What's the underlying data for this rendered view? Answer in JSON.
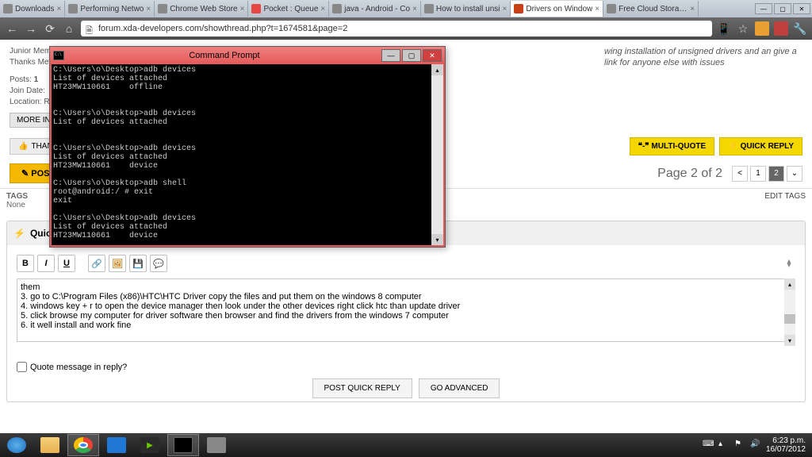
{
  "browser": {
    "tabs": [
      {
        "label": "Downloads"
      },
      {
        "label": "Performing Netwo"
      },
      {
        "label": "Chrome Web Store"
      },
      {
        "label": "Pocket : Queue"
      },
      {
        "label": "java - Android - Co"
      },
      {
        "label": "How to install unsi"
      },
      {
        "label": "Drivers on Window",
        "active": true
      },
      {
        "label": "Free Cloud Storage"
      }
    ],
    "url": "forum.xda-developers.com/showthread.php?t=1674581&page=2"
  },
  "post": {
    "rank": "Junior Mem",
    "thanks_meter": "Thanks Met",
    "posts_label": "Posts:",
    "posts_value": "1",
    "join_label": "Join Date:",
    "location_label": "Location: R",
    "more_info": "MORE INF",
    "body_text": "wing installation of unsigned drivers and\nan give a link for anyone else with issues",
    "thank_btn": "THANK",
    "post_reply": "POST R",
    "multi_quote": "❝-❞ MULTI-QUOTE",
    "quick_reply": "QUICK REPLY"
  },
  "pagination": {
    "info": "Page 2 of 2",
    "prev": "<",
    "p1": "1",
    "p2": "2",
    "more": "⌄"
  },
  "tags": {
    "label": "TAGS",
    "none": "None",
    "edit": "EDIT TAGS"
  },
  "quick_reply": {
    "header": "Quick Reply",
    "toolbar": {
      "b": "B",
      "i": "I",
      "u": "U"
    },
    "content": "them\n3. go to C:\\Program Files (x86)\\HTC\\HTC Driver copy the files and put them on the windows 8 computer\n4. windows key + r to open the device manager then look under the other devices right click htc than update driver\n5. click browse my computer for driver software then browser and find the drivers from the windows 7 computer\n6. it well install and work fine",
    "quote_label": "Quote message in reply?",
    "post_btn": "POST QUICK REPLY",
    "advanced_btn": "GO ADVANCED"
  },
  "cmd": {
    "title": "Command Prompt",
    "output": "C:\\Users\\o\\Desktop>adb devices\nList of devices attached\nHT23MW110661    offline\n\n\nC:\\Users\\o\\Desktop>adb devices\nList of devices attached\n\n\nC:\\Users\\o\\Desktop>adb devices\nList of devices attached\nHT23MW110661    device\n\nC:\\Users\\o\\Desktop>adb shell\nroot@android:/ # exit\nexit\n\nC:\\Users\\o\\Desktop>adb devices\nList of devices attached\nHT23MW110661    device\n\nC:\\Users\\o\\Desktop>_"
  },
  "taskbar": {
    "time": "6:23 p.m.",
    "date": "16/07/2012"
  }
}
